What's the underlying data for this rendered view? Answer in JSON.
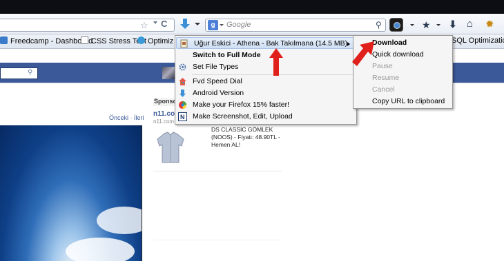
{
  "toolbar": {
    "search_placeholder": "Google",
    "search_engine_letter": "g"
  },
  "bookmarks": [
    {
      "label": "Freedcamp - Dashboard",
      "color": "#3a7ac9"
    },
    {
      "label": "CSS Stress Test",
      "color": "#ffffff"
    },
    {
      "label": "Optimiz",
      "color": "#3a9ad9"
    },
    {
      "label": "SQL Optimization",
      "color": "#ffffff"
    }
  ],
  "page": {
    "nav_links": "Önceki · İleri",
    "sponsored_label": "Sponso",
    "ad_title": "n11.co",
    "ad_url": "n11.com",
    "ad_text": "DS CLASSIC GÖMLEK (NOOS) - Fiyatı: 48.90TL - Hemen AL!"
  },
  "context_menu": {
    "items": [
      {
        "label": "Uğur Eskici - Athena - Bak Takılmana (14.5 MB)",
        "icon": "file-icon",
        "highlighted": true,
        "has_submenu": true
      },
      {
        "label": "Switch to Full Mode",
        "bold": true
      },
      {
        "label": "Set File Types",
        "icon": "gear-icon"
      },
      {
        "label": "Fvd Speed Dial",
        "icon": "speed-dial-icon"
      },
      {
        "label": "Android Version",
        "icon": "android-icon"
      },
      {
        "label": "Make your Firefox 15% faster!",
        "icon": "speed-icon"
      },
      {
        "label": "Make Screenshot, Edit, Upload",
        "icon": "screenshot-icon"
      }
    ]
  },
  "submenu": {
    "items": [
      {
        "label": "Download",
        "bold": true,
        "disabled": false
      },
      {
        "label": "Quick download",
        "disabled": false
      },
      {
        "label": "Pause",
        "disabled": true
      },
      {
        "label": "Resume",
        "disabled": true
      },
      {
        "label": "Cancel",
        "disabled": true
      },
      {
        "label": "Copy URL to clipboard",
        "disabled": false
      }
    ]
  },
  "colors": {
    "accent_blue": "#3b5998",
    "annotation_red": "#e0201b",
    "menu_highlight": "#cfdff4"
  }
}
